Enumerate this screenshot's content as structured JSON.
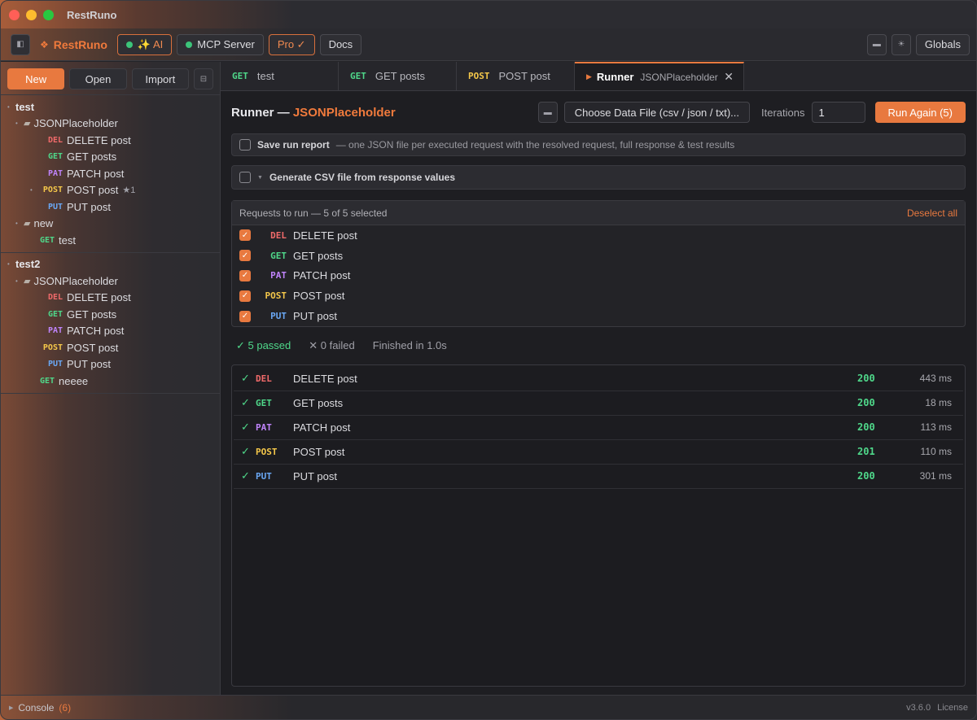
{
  "window": {
    "title": "RestRuno"
  },
  "toolbar": {
    "brand": "RestRuno",
    "ai_label": "✨ AI",
    "mcp_label": "MCP Server",
    "pro_label": "Pro ✓",
    "docs_label": "Docs",
    "globals_label": "Globals"
  },
  "sidebar": {
    "new_label": "New",
    "open_label": "Open",
    "import_label": "Import",
    "collections": [
      {
        "name": "test",
        "folders": [
          {
            "name": "JSONPlaceholder",
            "requests": [
              {
                "method": "DEL",
                "name": "DELETE post"
              },
              {
                "method": "GET",
                "name": "GET posts"
              },
              {
                "method": "PAT",
                "name": "PATCH post"
              },
              {
                "method": "POST",
                "name": "POST post",
                "badge": "★1"
              },
              {
                "method": "PUT",
                "name": "PUT post"
              }
            ]
          },
          {
            "name": "new",
            "requests": [
              {
                "method": "GET",
                "name": "test"
              }
            ]
          }
        ]
      },
      {
        "name": "test2",
        "folders": [
          {
            "name": "JSONPlaceholder",
            "requests": [
              {
                "method": "DEL",
                "name": "DELETE post"
              },
              {
                "method": "GET",
                "name": "GET posts"
              },
              {
                "method": "PAT",
                "name": "PATCH post"
              },
              {
                "method": "POST",
                "name": "POST post"
              },
              {
                "method": "PUT",
                "name": "PUT post"
              }
            ]
          }
        ],
        "loose": [
          {
            "method": "GET",
            "name": "neeee"
          }
        ]
      }
    ]
  },
  "tabs": [
    {
      "method": "GET",
      "label": "test"
    },
    {
      "method": "GET",
      "label": "GET posts"
    },
    {
      "method": "POST",
      "label": "POST post"
    },
    {
      "label": "Runner",
      "sub": "JSONPlaceholder",
      "active": true
    }
  ],
  "runner": {
    "title_prefix": "Runner —",
    "title_collection": "JSONPlaceholder",
    "data_file_label": "Choose Data File (csv / json / txt)...",
    "iterations_label": "Iterations",
    "iterations_value": "1",
    "run_again_label": "Run Again (5)",
    "save_report_title": "Save run report",
    "save_report_desc": "— one JSON file per executed request with the resolved request, full response & test results",
    "csv_label": "Generate CSV file from response values",
    "requests_header": "Requests to run — 5 of 5 selected",
    "deselect_label": "Deselect all",
    "requests": [
      {
        "method": "DEL",
        "name": "DELETE post"
      },
      {
        "method": "GET",
        "name": "GET posts"
      },
      {
        "method": "PAT",
        "name": "PATCH post"
      },
      {
        "method": "POST",
        "name": "POST post"
      },
      {
        "method": "PUT",
        "name": "PUT post"
      }
    ],
    "summary": {
      "passed": "✓ 5 passed",
      "failed": "✕ 0 failed",
      "finished": "Finished in 1.0s"
    },
    "results": [
      {
        "method": "DEL",
        "name": "DELETE post",
        "status": "200",
        "time": "443 ms"
      },
      {
        "method": "GET",
        "name": "GET posts",
        "status": "200",
        "time": "18 ms"
      },
      {
        "method": "PAT",
        "name": "PATCH post",
        "status": "200",
        "time": "113 ms"
      },
      {
        "method": "POST",
        "name": "POST post",
        "status": "201",
        "time": "110 ms"
      },
      {
        "method": "PUT",
        "name": "PUT post",
        "status": "200",
        "time": "301 ms"
      }
    ]
  },
  "statusbar": {
    "console_label": "Console",
    "console_count": "(6)",
    "version": "v3.6.0",
    "license": "License"
  },
  "colors": {
    "accent": "#e8793f",
    "method_del": "#f06a6a",
    "method_get": "#4fd88a",
    "method_pat": "#c084fc",
    "method_post": "#f5c84a",
    "method_put": "#6aa8f5",
    "success": "#4fd88a"
  },
  "icons": {
    "sidebar_toggle": "sidebar-toggle-icon",
    "brand": "restruno-logo-icon",
    "folder": "folder-icon",
    "layout": "layout-icon",
    "theme": "sun-icon",
    "close": "close-icon",
    "check": "check-icon"
  }
}
